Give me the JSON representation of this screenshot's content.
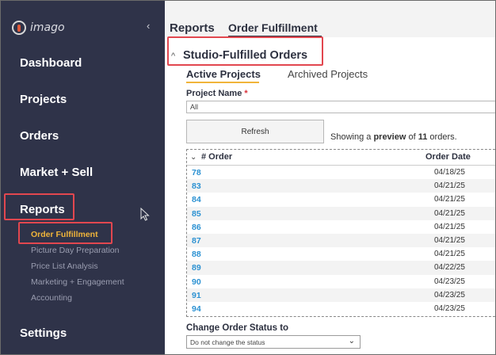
{
  "app": {
    "logo_text": "imago"
  },
  "sidebar": {
    "collapse_glyph": "‹",
    "items": [
      {
        "label": "Dashboard"
      },
      {
        "label": "Projects"
      },
      {
        "label": "Orders"
      },
      {
        "label": "Market + Sell"
      },
      {
        "label": "Reports"
      },
      {
        "label": "Settings"
      }
    ],
    "report_subitems": [
      {
        "label": "Order Fulfillment",
        "active": true
      },
      {
        "label": "Picture Day Preparation"
      },
      {
        "label": "Price List Analysis"
      },
      {
        "label": "Marketing + Engagement"
      },
      {
        "label": "Accounting"
      }
    ]
  },
  "header": {
    "section": "Reports",
    "page": "Order Fulfillment"
  },
  "panel": {
    "chevron": "^",
    "title": "Studio-Fulfilled Orders",
    "tabs": [
      {
        "label": "Active Projects"
      },
      {
        "label": "Archived Projects"
      }
    ],
    "project_name_label": "Project Name",
    "required_mark": "*",
    "project_name_value": "All",
    "refresh_label": "Refresh",
    "showing_prefix": "Showing a",
    "showing_bold": "preview",
    "showing_mid": "of",
    "showing_count": "11",
    "showing_suffix": "orders.",
    "table": {
      "sort_chevron": "⌄",
      "col_order": "# Order",
      "col_date": "Order Date",
      "rows": [
        {
          "order": "78",
          "date": "04/18/25"
        },
        {
          "order": "83",
          "date": "04/21/25"
        },
        {
          "order": "84",
          "date": "04/21/25"
        },
        {
          "order": "85",
          "date": "04/21/25"
        },
        {
          "order": "86",
          "date": "04/21/25"
        },
        {
          "order": "87",
          "date": "04/21/25"
        },
        {
          "order": "88",
          "date": "04/21/25"
        },
        {
          "order": "89",
          "date": "04/22/25"
        },
        {
          "order": "90",
          "date": "04/23/25"
        },
        {
          "order": "91",
          "date": "04/23/25"
        },
        {
          "order": "94",
          "date": "04/23/25"
        }
      ]
    },
    "status_label": "Change Order Status to",
    "status_value": "Do not change the status"
  },
  "colors": {
    "sidebar_bg": "#2f3349",
    "accent": "#f0b43a",
    "link": "#2b91d2",
    "highlight": "#e2474f"
  },
  "icons": {
    "cursor": "arrow-cursor-icon",
    "collapse": "chevron-left-icon"
  }
}
